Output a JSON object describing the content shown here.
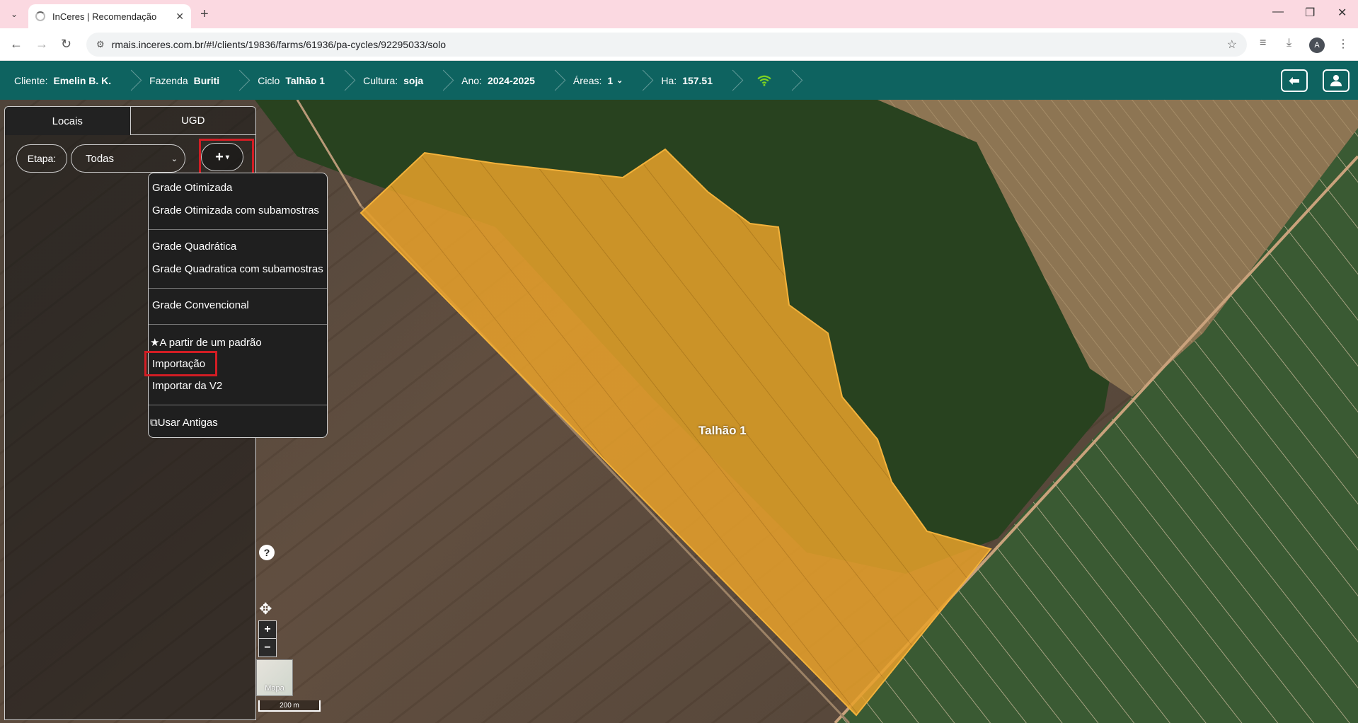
{
  "browser": {
    "tab_title": "InCeres | Recomendação",
    "url": "rmais.inceres.com.br/#!/clients/19836/farms/61936/pa-cycles/92295033/solo",
    "profile_initial": "A"
  },
  "header": {
    "cliente_label": "Cliente:",
    "cliente_value": "Emelin B. K.",
    "fazenda_label": "Fazenda",
    "fazenda_value": "Buriti",
    "ciclo_label": "Ciclo",
    "ciclo_value": "Talhão 1",
    "cultura_label": "Cultura:",
    "cultura_value": "soja",
    "ano_label": "Ano:",
    "ano_value": "2024-2025",
    "areas_label": "Áreas:",
    "areas_value": "1",
    "ha_label": "Ha:",
    "ha_value": "157.51",
    "wifi_icon": "wifi-icon",
    "back_icon": "arrow-left-icon",
    "user_icon": "user-icon"
  },
  "panel": {
    "tabs": [
      {
        "label": "Locais"
      },
      {
        "label": "UGD"
      }
    ],
    "etapa_label": "Etapa:",
    "etapa_selected": "Todas",
    "add_label": "+"
  },
  "dropdown": {
    "items": [
      {
        "label": "Grade Otimizada"
      },
      {
        "label": "Grade Otimizada com subamostras"
      },
      {
        "label": "Grade Quadrática"
      },
      {
        "label": "Grade Quadratica com subamostras"
      },
      {
        "label": "Grade Convencional"
      },
      {
        "label": "A partir de um padrão",
        "icon": "star-icon"
      },
      {
        "label": "Importação"
      },
      {
        "label": "Importar da V2"
      },
      {
        "label": "Usar Antigas",
        "icon": "copy-icon"
      }
    ]
  },
  "map": {
    "field_label": "Talhão 1",
    "field_color": "#e8a12a",
    "basemap_label": "Mapa",
    "scale_label": "200 m",
    "help_label": "?",
    "zoom_in": "+",
    "zoom_out": "−"
  },
  "colors": {
    "header_bg": "#0e6360",
    "highlight": "#d21d24",
    "tabbar_bg": "#fbd9e1"
  }
}
